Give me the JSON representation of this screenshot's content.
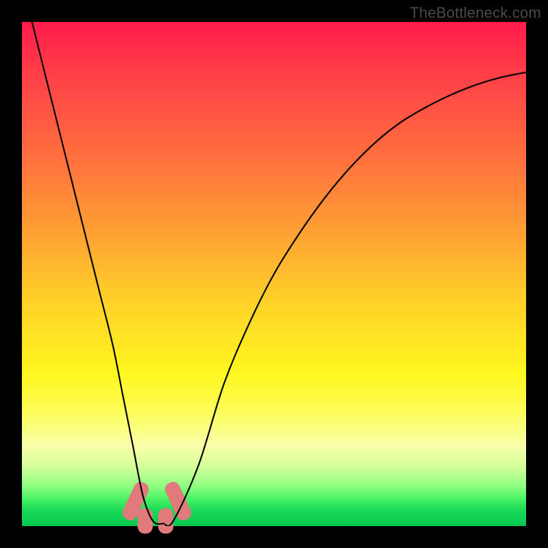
{
  "watermark": "TheBottleneck.com",
  "chart_data": {
    "type": "line",
    "title": "",
    "xlabel": "",
    "ylabel": "",
    "xlim": [
      0,
      100
    ],
    "ylim": [
      0,
      100
    ],
    "series": [
      {
        "name": "bottleneck-curve",
        "x": [
          2,
          5,
          10,
          15,
          18,
          20,
          22,
          24,
          26,
          28,
          30,
          35,
          40,
          45,
          50,
          55,
          60,
          65,
          70,
          75,
          80,
          85,
          90,
          95,
          100
        ],
        "values": [
          100,
          88,
          68,
          48,
          36,
          26,
          16,
          6,
          1,
          0.5,
          1,
          12,
          28,
          40,
          50,
          58,
          65,
          71,
          76,
          80,
          83,
          85.5,
          87.5,
          89,
          90
        ]
      }
    ],
    "markers": [
      {
        "name": "left-hump-marker",
        "x": 22.5,
        "y": 5,
        "w": 3,
        "h": 8,
        "rot": 25
      },
      {
        "name": "bottom-left-marker",
        "x": 24.5,
        "y": 1,
        "w": 3,
        "h": 5,
        "rot": 0
      },
      {
        "name": "bottom-right-marker",
        "x": 28.5,
        "y": 1,
        "w": 3,
        "h": 5,
        "rot": 0
      },
      {
        "name": "right-hump-marker",
        "x": 31,
        "y": 5,
        "w": 3,
        "h": 8,
        "rot": -25
      }
    ],
    "gradient_stops": [
      {
        "pct": 0,
        "color": "#ff1a4a"
      },
      {
        "pct": 40,
        "color": "#ff9a35"
      },
      {
        "pct": 70,
        "color": "#fff81f"
      },
      {
        "pct": 100,
        "color": "#06c94e"
      }
    ]
  }
}
